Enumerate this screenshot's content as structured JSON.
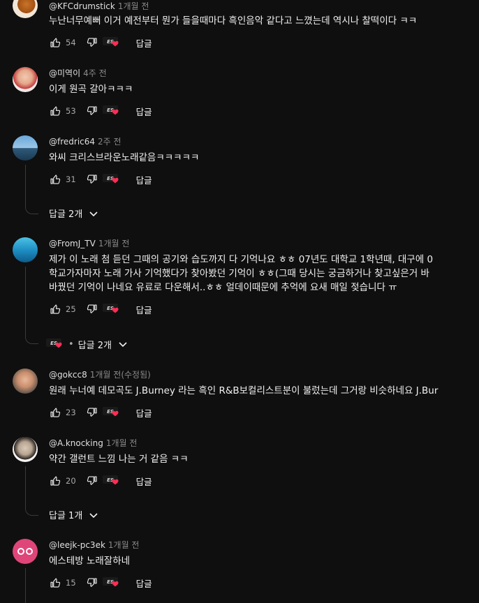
{
  "comments": [
    {
      "author": "@KFCdrumstick",
      "time": "1개월 전",
      "lines": [
        "누난너무예뻐 이거 예전부터 뭔가 들을때마다 흑인음악 같다고 느꼈는데 역시나 찰떡이다 ㅋㅋ"
      ],
      "likes": "54",
      "reply": "답글"
    },
    {
      "author": "@미역이",
      "time": "4주 전",
      "lines": [
        "이게 원곡 갈아ㅋㅋㅋ"
      ],
      "likes": "53",
      "reply": "답글"
    },
    {
      "author": "@fredric64",
      "time": "2주 전",
      "lines": [
        "와씨 크리스브라운노래같음ㅋㅋㅋㅋㅋ"
      ],
      "likes": "31",
      "reply": "답글",
      "replies_label": "답글 2개"
    },
    {
      "author": "@FromJ_TV",
      "time": "1개월 전",
      "lines": [
        "제가 이 노래 첨 듣던 그때의 공기와 습도까지 다 기억나요 ㅎㅎ 07년도 대학교 1학년때, 대구에 0",
        "학교가자마자 노래 가사 기억했다가 찾아봤던 기억이 ㅎㅎ(그때 당시는 궁금하거나 찾고싶은거 바",
        "바꿨던 기억이 나네요 유료로 다운해서..ㅎㅎ  얼데이때문에 추억에 요새 매일 젖습니다 ㅠ"
      ],
      "likes": "25",
      "reply": "답글",
      "replies_label": "답글 2개"
    },
    {
      "author": "@gokcc8",
      "time": "1개월 전(수정됨)",
      "lines": [
        "원래 누너예 데모곡도 J.Burney 라는 흑인 R&B보컬리스트분이 불렀는데 그거랑 비슷하네요 J.Bur"
      ],
      "likes": "23",
      "reply": "답글"
    },
    {
      "author": "@A.knocking",
      "time": "1개월 전",
      "lines": [
        "약간 갤런트 느낌 나는 거 같음 ㅋㅋ"
      ],
      "likes": "20",
      "reply": "답글",
      "replies_label": "답글 1개"
    },
    {
      "author": "@leejk-pc3ek",
      "time": "1개월 전",
      "lines": [
        "에스테방 노래잘하네"
      ],
      "likes": "15",
      "reply": "답글"
    }
  ],
  "separator": "•",
  "icons": {
    "like": "thumb-up-icon",
    "dislike": "thumb-down-icon",
    "heart": "creator-heart-icon",
    "chevron": "chevron-down-icon"
  },
  "colors": {
    "background": "#0f0f0f",
    "text": "#f1f1f1",
    "muted": "#aaaaaa",
    "heart": "#ff2d55"
  }
}
